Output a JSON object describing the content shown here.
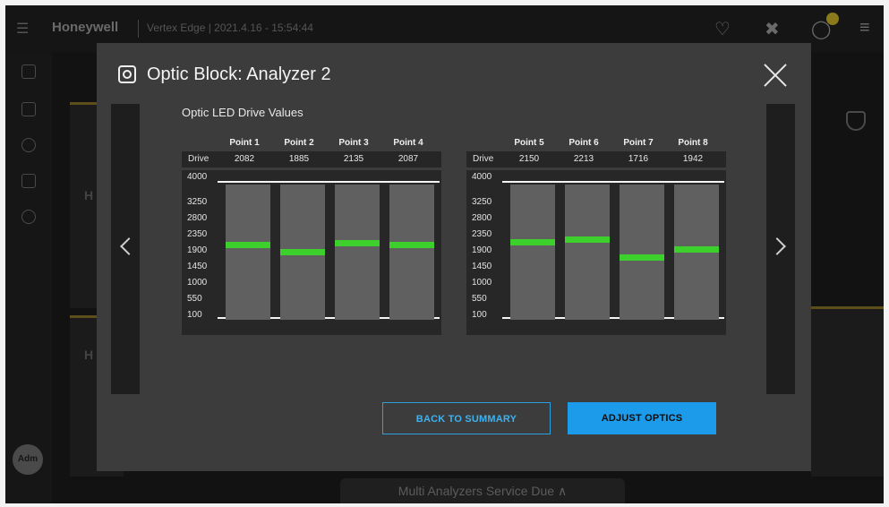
{
  "app": {
    "brand": "Honeywell",
    "info": "Vertex Edge | 2021.4.16 - 15:54:44",
    "admin_label": "Adm",
    "status_bar": "Multi Analyzers Service Due ∧"
  },
  "modal": {
    "title": "Optic Block: Analyzer 2",
    "section_label": "Optic LED Drive Values",
    "drive_label": "Drive",
    "ticks": [
      "4000",
      "3250",
      "2800",
      "2350",
      "1900",
      "1450",
      "1000",
      "550",
      "100"
    ],
    "tick_values": [
      4000,
      3250,
      2800,
      2350,
      1900,
      1450,
      1000,
      550,
      100
    ],
    "panels": [
      {
        "points": [
          {
            "name": "Point 1",
            "drive": "2082",
            "value": 2082
          },
          {
            "name": "Point 2",
            "drive": "1885",
            "value": 1885
          },
          {
            "name": "Point 3",
            "drive": "2135",
            "value": 2135
          },
          {
            "name": "Point 4",
            "drive": "2087",
            "value": 2087
          }
        ]
      },
      {
        "points": [
          {
            "name": "Point 5",
            "drive": "2150",
            "value": 2150
          },
          {
            "name": "Point 6",
            "drive": "2213",
            "value": 2213
          },
          {
            "name": "Point 7",
            "drive": "1716",
            "value": 1716
          },
          {
            "name": "Point 8",
            "drive": "1942",
            "value": 1942
          }
        ]
      }
    ],
    "buttons": {
      "back": "BACK TO SUMMARY",
      "adjust": "ADJUST OPTICS"
    }
  },
  "colors": {
    "accent": "#1c9bea",
    "indicator": "#3dcf2c"
  }
}
